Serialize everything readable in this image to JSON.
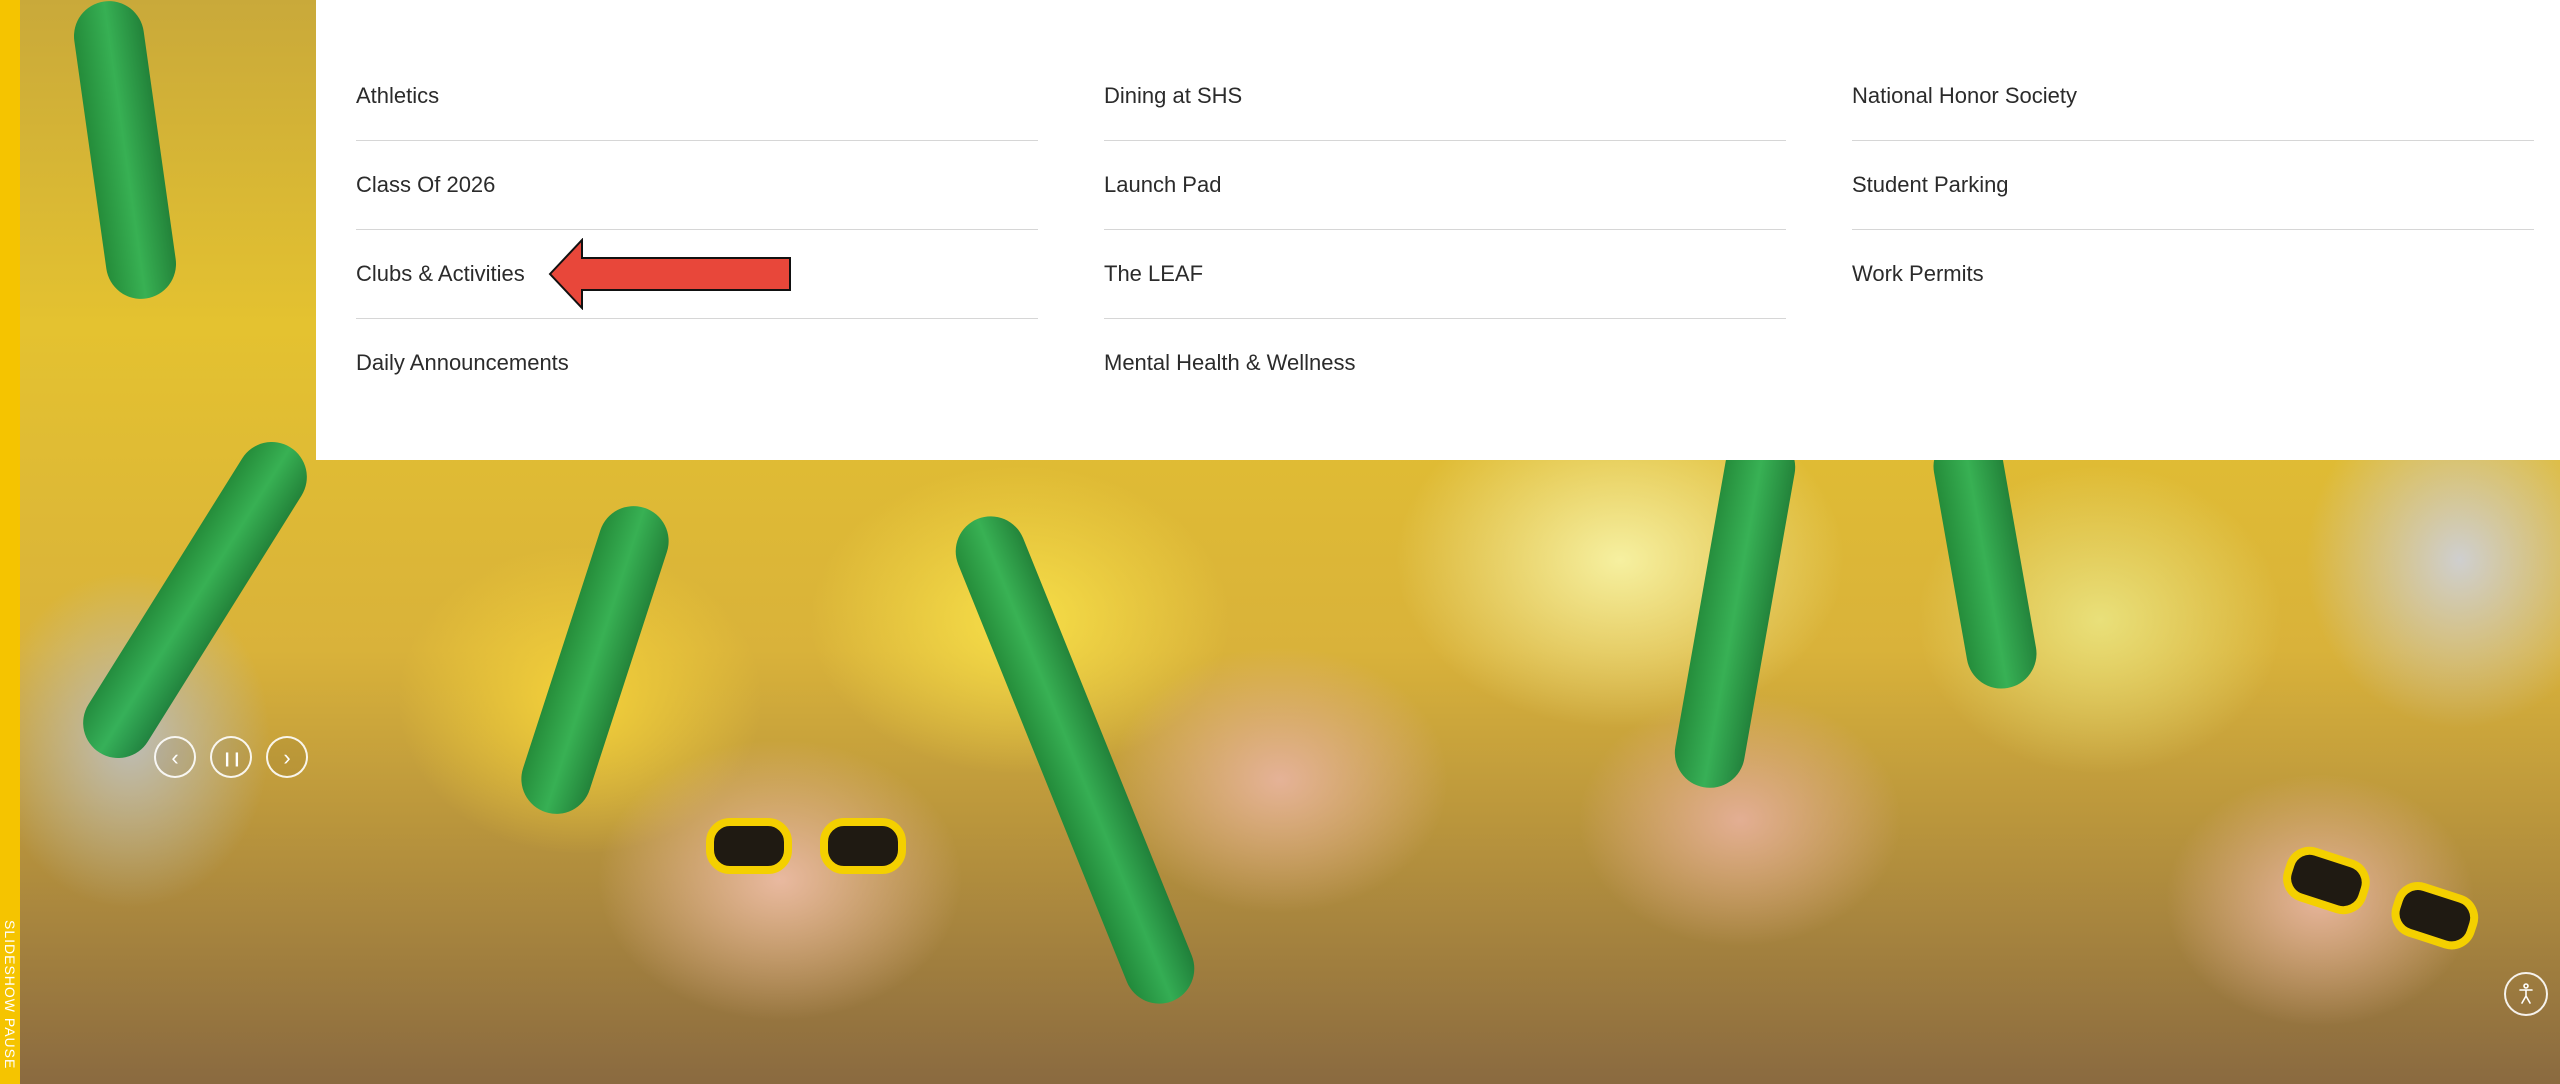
{
  "sidebar": {
    "accent_color": "#f5c400",
    "vertical_text": "SLIDESHOW PAUSE"
  },
  "menu": {
    "columns": [
      {
        "items": [
          "Athletics",
          "Class Of 2026",
          "Clubs & Activities",
          "Daily Announcements"
        ]
      },
      {
        "items": [
          "Dining at SHS",
          "Launch Pad",
          "The LEAF",
          "Mental Health & Wellness"
        ]
      },
      {
        "items": [
          "National Honor Society",
          "Student Parking",
          "Work Permits"
        ]
      }
    ],
    "highlighted_item": "Clubs & Activities",
    "annotation_color": "#e8473a"
  },
  "carousel": {
    "prev_icon": "chevron-left-icon",
    "pause_icon": "pause-icon",
    "next_icon": "chevron-right-icon",
    "prev_glyph": "‹",
    "pause_glyph": "❙❙",
    "next_glyph": "›"
  },
  "accessibility": {
    "icon": "accessibility-icon"
  }
}
